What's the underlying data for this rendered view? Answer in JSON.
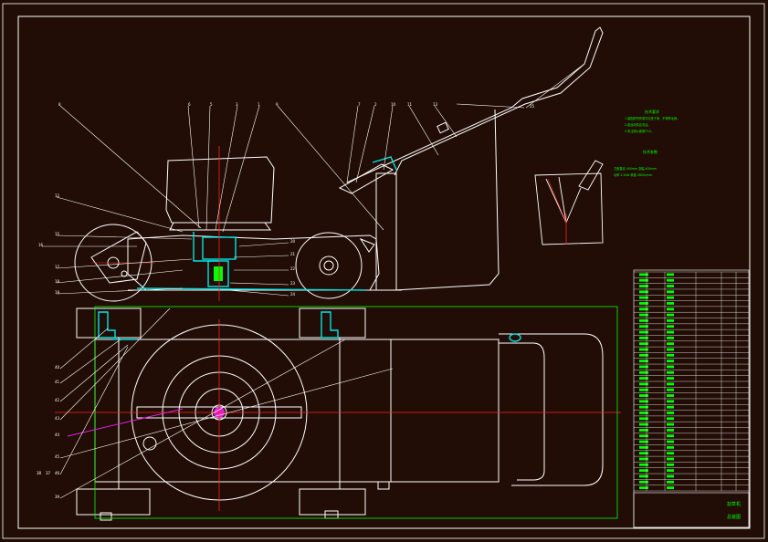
{
  "drawing": {
    "title": "",
    "colors": {
      "background": "#210d05",
      "line": "#ffffff",
      "green": "#00ff00",
      "cyan": "#00e5e5",
      "red": "#ff2020",
      "magenta": "#e020e0"
    },
    "side_view_labels": [
      "8",
      "6",
      "5",
      "3",
      "1",
      "9",
      "7",
      "2",
      "10",
      "11",
      "13",
      "12",
      "15",
      "16",
      "17",
      "18",
      "19",
      "20",
      "21",
      "22",
      "23",
      "24",
      "25"
    ],
    "plan_view_labels": [
      "40",
      "41",
      "42",
      "43",
      "44",
      "45",
      "46",
      "39",
      "38",
      "37"
    ],
    "notes": {
      "heading": "技术要求",
      "lines": [
        "1.装配前所有零件清洗干净，不得有毛刺。",
        "2.各运动件应灵活。",
        "3.未注明公差按IT12。"
      ]
    },
    "specs": {
      "heading": "技术参数",
      "lines": [
        "刀盘直径 400mm   割幅 400mm",
        "功率 2.2kW   转速 2800r/min"
      ]
    },
    "bom": {
      "rows": 38,
      "columns": 6
    },
    "title_block": {
      "name": "割草机",
      "drawing_no": "总装图"
    }
  }
}
